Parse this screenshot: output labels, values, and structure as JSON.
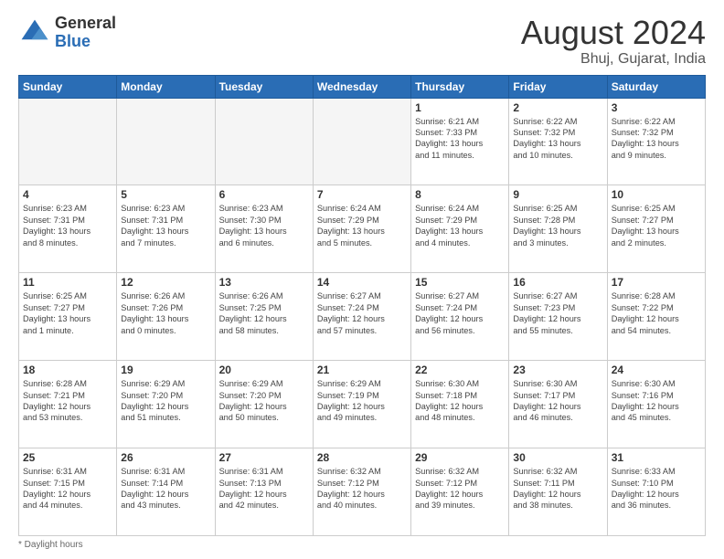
{
  "logo": {
    "general": "General",
    "blue": "Blue"
  },
  "header": {
    "month": "August 2024",
    "location": "Bhuj, Gujarat, India"
  },
  "days_of_week": [
    "Sunday",
    "Monday",
    "Tuesday",
    "Wednesday",
    "Thursday",
    "Friday",
    "Saturday"
  ],
  "weeks": [
    [
      {
        "day": "",
        "info": ""
      },
      {
        "day": "",
        "info": ""
      },
      {
        "day": "",
        "info": ""
      },
      {
        "day": "",
        "info": ""
      },
      {
        "day": "1",
        "info": "Sunrise: 6:21 AM\nSunset: 7:33 PM\nDaylight: 13 hours\nand 11 minutes."
      },
      {
        "day": "2",
        "info": "Sunrise: 6:22 AM\nSunset: 7:32 PM\nDaylight: 13 hours\nand 10 minutes."
      },
      {
        "day": "3",
        "info": "Sunrise: 6:22 AM\nSunset: 7:32 PM\nDaylight: 13 hours\nand 9 minutes."
      }
    ],
    [
      {
        "day": "4",
        "info": "Sunrise: 6:23 AM\nSunset: 7:31 PM\nDaylight: 13 hours\nand 8 minutes."
      },
      {
        "day": "5",
        "info": "Sunrise: 6:23 AM\nSunset: 7:31 PM\nDaylight: 13 hours\nand 7 minutes."
      },
      {
        "day": "6",
        "info": "Sunrise: 6:23 AM\nSunset: 7:30 PM\nDaylight: 13 hours\nand 6 minutes."
      },
      {
        "day": "7",
        "info": "Sunrise: 6:24 AM\nSunset: 7:29 PM\nDaylight: 13 hours\nand 5 minutes."
      },
      {
        "day": "8",
        "info": "Sunrise: 6:24 AM\nSunset: 7:29 PM\nDaylight: 13 hours\nand 4 minutes."
      },
      {
        "day": "9",
        "info": "Sunrise: 6:25 AM\nSunset: 7:28 PM\nDaylight: 13 hours\nand 3 minutes."
      },
      {
        "day": "10",
        "info": "Sunrise: 6:25 AM\nSunset: 7:27 PM\nDaylight: 13 hours\nand 2 minutes."
      }
    ],
    [
      {
        "day": "11",
        "info": "Sunrise: 6:25 AM\nSunset: 7:27 PM\nDaylight: 13 hours\nand 1 minute."
      },
      {
        "day": "12",
        "info": "Sunrise: 6:26 AM\nSunset: 7:26 PM\nDaylight: 13 hours\nand 0 minutes."
      },
      {
        "day": "13",
        "info": "Sunrise: 6:26 AM\nSunset: 7:25 PM\nDaylight: 12 hours\nand 58 minutes."
      },
      {
        "day": "14",
        "info": "Sunrise: 6:27 AM\nSunset: 7:24 PM\nDaylight: 12 hours\nand 57 minutes."
      },
      {
        "day": "15",
        "info": "Sunrise: 6:27 AM\nSunset: 7:24 PM\nDaylight: 12 hours\nand 56 minutes."
      },
      {
        "day": "16",
        "info": "Sunrise: 6:27 AM\nSunset: 7:23 PM\nDaylight: 12 hours\nand 55 minutes."
      },
      {
        "day": "17",
        "info": "Sunrise: 6:28 AM\nSunset: 7:22 PM\nDaylight: 12 hours\nand 54 minutes."
      }
    ],
    [
      {
        "day": "18",
        "info": "Sunrise: 6:28 AM\nSunset: 7:21 PM\nDaylight: 12 hours\nand 53 minutes."
      },
      {
        "day": "19",
        "info": "Sunrise: 6:29 AM\nSunset: 7:20 PM\nDaylight: 12 hours\nand 51 minutes."
      },
      {
        "day": "20",
        "info": "Sunrise: 6:29 AM\nSunset: 7:20 PM\nDaylight: 12 hours\nand 50 minutes."
      },
      {
        "day": "21",
        "info": "Sunrise: 6:29 AM\nSunset: 7:19 PM\nDaylight: 12 hours\nand 49 minutes."
      },
      {
        "day": "22",
        "info": "Sunrise: 6:30 AM\nSunset: 7:18 PM\nDaylight: 12 hours\nand 48 minutes."
      },
      {
        "day": "23",
        "info": "Sunrise: 6:30 AM\nSunset: 7:17 PM\nDaylight: 12 hours\nand 46 minutes."
      },
      {
        "day": "24",
        "info": "Sunrise: 6:30 AM\nSunset: 7:16 PM\nDaylight: 12 hours\nand 45 minutes."
      }
    ],
    [
      {
        "day": "25",
        "info": "Sunrise: 6:31 AM\nSunset: 7:15 PM\nDaylight: 12 hours\nand 44 minutes."
      },
      {
        "day": "26",
        "info": "Sunrise: 6:31 AM\nSunset: 7:14 PM\nDaylight: 12 hours\nand 43 minutes."
      },
      {
        "day": "27",
        "info": "Sunrise: 6:31 AM\nSunset: 7:13 PM\nDaylight: 12 hours\nand 42 minutes."
      },
      {
        "day": "28",
        "info": "Sunrise: 6:32 AM\nSunset: 7:12 PM\nDaylight: 12 hours\nand 40 minutes."
      },
      {
        "day": "29",
        "info": "Sunrise: 6:32 AM\nSunset: 7:12 PM\nDaylight: 12 hours\nand 39 minutes."
      },
      {
        "day": "30",
        "info": "Sunrise: 6:32 AM\nSunset: 7:11 PM\nDaylight: 12 hours\nand 38 minutes."
      },
      {
        "day": "31",
        "info": "Sunrise: 6:33 AM\nSunset: 7:10 PM\nDaylight: 12 hours\nand 36 minutes."
      }
    ]
  ],
  "footer": {
    "note": "Daylight hours"
  }
}
